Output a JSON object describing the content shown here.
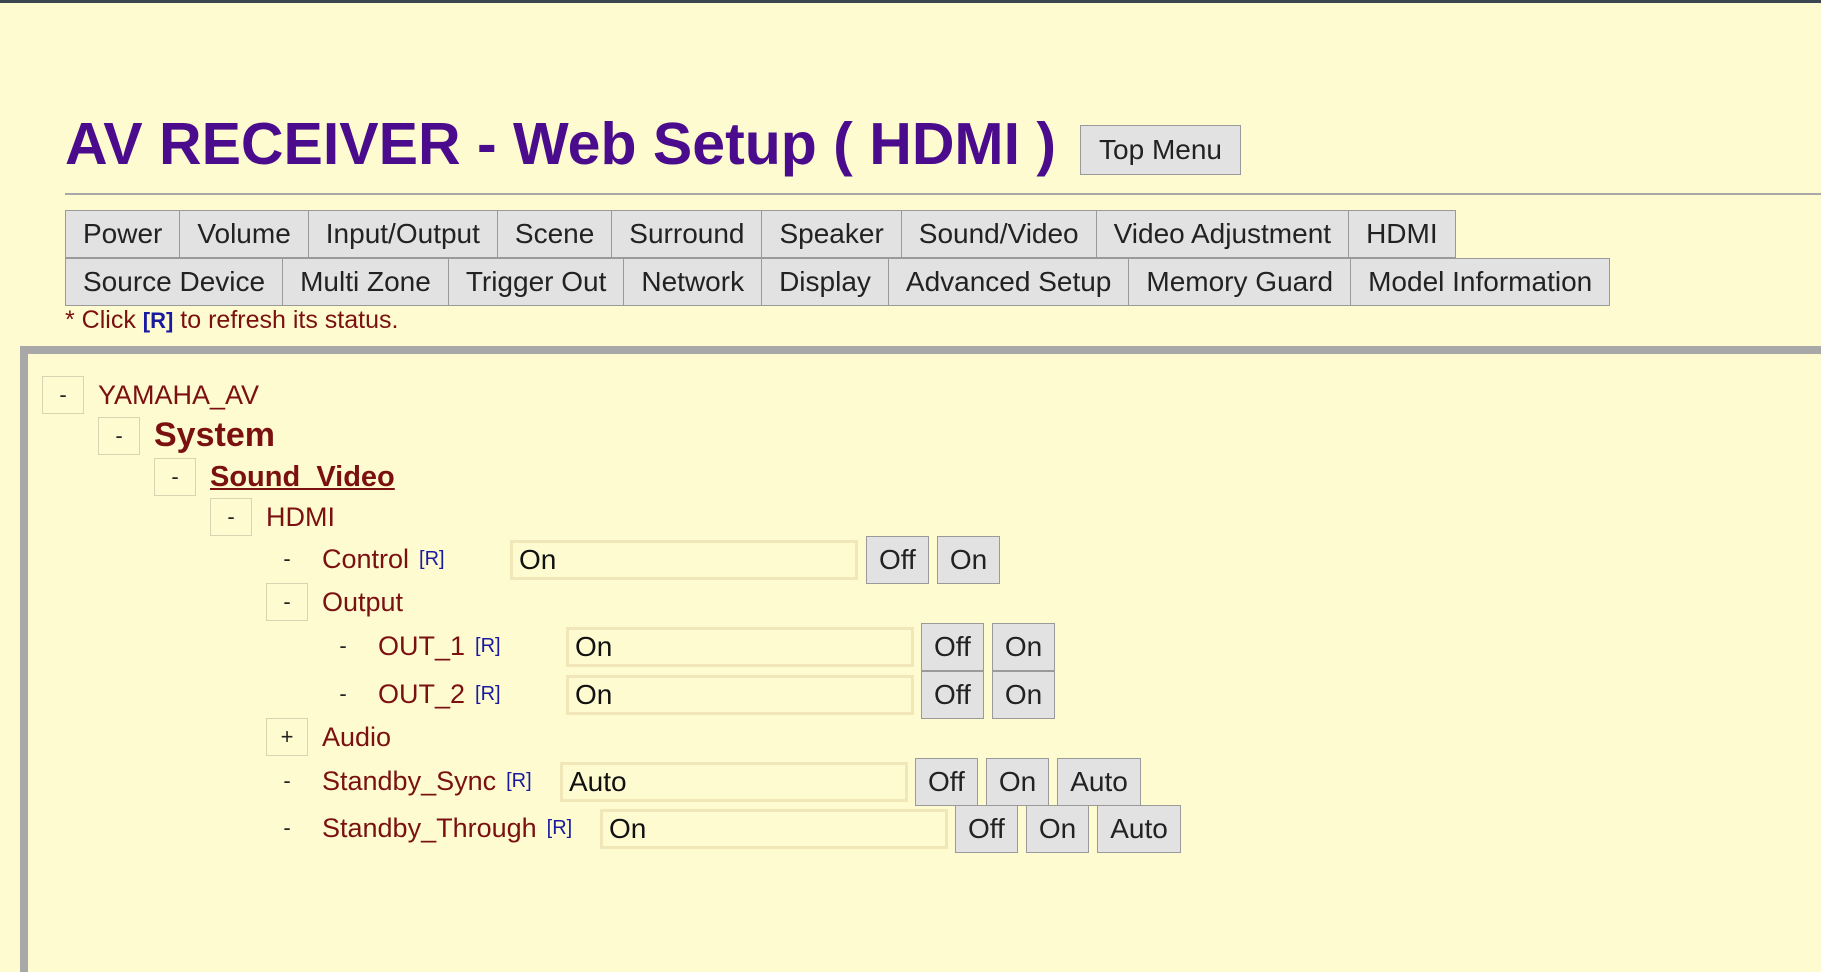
{
  "header": {
    "title": "AV RECEIVER - Web Setup ( HDMI )",
    "top_menu_label": "Top Menu"
  },
  "menu": {
    "row1": [
      "Power",
      "Volume",
      "Input/Output",
      "Scene",
      "Surround",
      "Speaker",
      "Sound/Video",
      "Video Adjustment",
      "HDMI"
    ],
    "row2": [
      "Source Device",
      "Multi Zone",
      "Trigger Out",
      "Network",
      "Display",
      "Advanced Setup",
      "Memory Guard",
      "Model Information"
    ]
  },
  "note": {
    "prefix": "* Click ",
    "refresh": "[R]",
    "suffix": " to refresh its status."
  },
  "tree": {
    "root": {
      "toggle": "-",
      "label": "YAMAHA_AV"
    },
    "system": {
      "toggle": "-",
      "label": "System"
    },
    "sound_video": {
      "toggle": "-",
      "label": "Sound_Video"
    },
    "hdmi": {
      "toggle": "-",
      "label": "HDMI"
    },
    "control": {
      "toggle": "-",
      "label": "Control",
      "refresh": "[R]",
      "value": "On",
      "options": [
        "Off",
        "On"
      ]
    },
    "output": {
      "toggle": "-",
      "label": "Output"
    },
    "out_1": {
      "toggle": "-",
      "label": "OUT_1",
      "refresh": "[R]",
      "value": "On",
      "options": [
        "Off",
        "On"
      ]
    },
    "out_2": {
      "toggle": "-",
      "label": "OUT_2",
      "refresh": "[R]",
      "value": "On",
      "options": [
        "Off",
        "On"
      ]
    },
    "audio": {
      "toggle": "+",
      "label": "Audio"
    },
    "standby_sync": {
      "toggle": "-",
      "label": "Standby_Sync",
      "refresh": "[R]",
      "value": "Auto",
      "options": [
        "Off",
        "On",
        "Auto"
      ]
    },
    "standby_through": {
      "toggle": "-",
      "label": "Standby_Through",
      "refresh": "[R]",
      "value": "On",
      "options": [
        "Off",
        "On",
        "Auto"
      ]
    }
  },
  "colors": {
    "background": "#fefbd0",
    "title": "#4a0c8c",
    "label": "#7a1010",
    "refresh_link": "#1a1aa0"
  }
}
